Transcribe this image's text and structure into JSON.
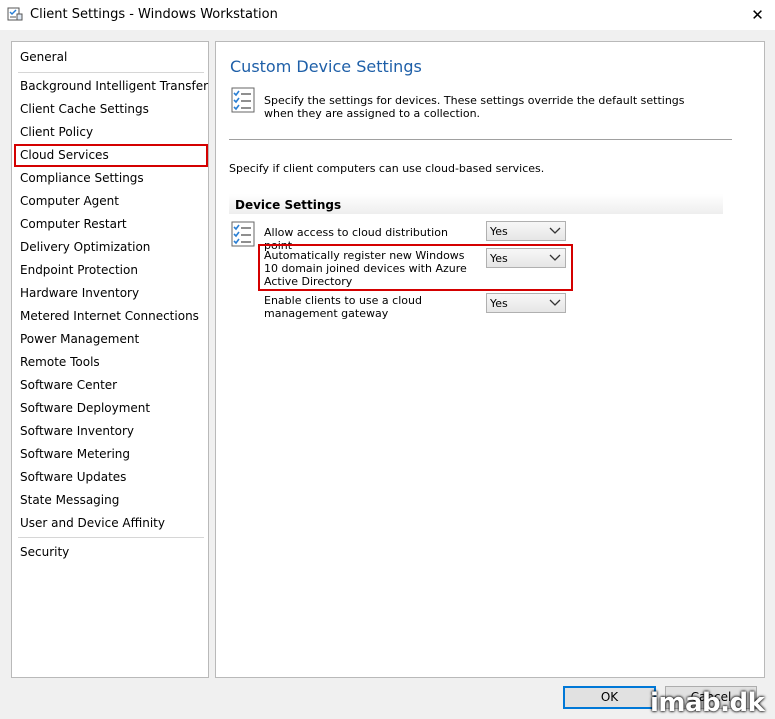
{
  "window": {
    "title": "Client Settings - Windows Workstation",
    "close_glyph": "✕"
  },
  "nav": {
    "items": [
      "General",
      "Background Intelligent Transfer",
      "Client Cache Settings",
      "Client Policy",
      "Cloud Services",
      "Compliance Settings",
      "Computer Agent",
      "Computer Restart",
      "Delivery Optimization",
      "Endpoint Protection",
      "Hardware Inventory",
      "Metered Internet Connections",
      "Power Management",
      "Remote Tools",
      "Software Center",
      "Software Deployment",
      "Software Inventory",
      "Software Metering",
      "Software Updates",
      "State Messaging",
      "User and Device Affinity",
      "Security"
    ],
    "selected": "Cloud Services"
  },
  "panel": {
    "title": "Custom Device Settings",
    "description": "Specify the settings for devices. These settings override the default settings when they are assigned to a collection.",
    "specify_text": "Specify if client computers can use cloud-based services.",
    "section_header": "Device Settings",
    "settings": [
      {
        "label": "Allow access to cloud distribution point",
        "value": "Yes"
      },
      {
        "label": "Automatically register new Windows 10 domain joined devices with Azure Active Directory",
        "value": "Yes"
      },
      {
        "label": "Enable clients to use a cloud management gateway",
        "value": "Yes"
      }
    ]
  },
  "buttons": {
    "ok": "OK",
    "cancel": "Cancel"
  },
  "watermark": "imab.dk",
  "colors": {
    "accent": "#1e5fa8",
    "highlight": "#d40000",
    "focus": "#0078d7"
  },
  "icons": {
    "window": "client-settings-icon",
    "close": "close-icon",
    "settings": "checklist-icon",
    "dropdown": "chevron-down-icon"
  }
}
